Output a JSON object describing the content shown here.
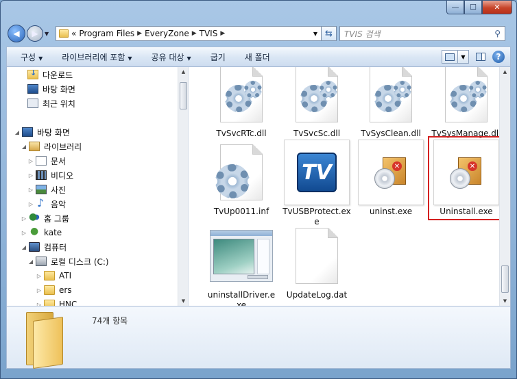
{
  "window": {
    "caption_buttons": {
      "minimize": "—",
      "maximize": "☐",
      "close": "✕"
    }
  },
  "address": {
    "prefix": "«",
    "crumbs": [
      "Program Files",
      "EveryZone",
      "TVIS"
    ],
    "search_placeholder": "TVIS 검색",
    "search_icon": "search-icon"
  },
  "toolbar": {
    "organize": "구성",
    "include_library": "라이브러리에 포함",
    "share": "공유 대상",
    "burn": "굽기",
    "new_folder": "새 폴더"
  },
  "nav": {
    "favorites": [
      {
        "label": "다운로드",
        "icon": "download-folder-icon"
      },
      {
        "label": "바탕 화면",
        "icon": "desktop-icon"
      },
      {
        "label": "최근 위치",
        "icon": "recent-places-icon"
      }
    ],
    "tree": [
      {
        "label": "바탕 화면",
        "icon": "desktop-icon",
        "expanded": true
      },
      {
        "label": "라이브러리",
        "icon": "library-icon",
        "expanded": true
      },
      {
        "label": "문서",
        "icon": "documents-icon"
      },
      {
        "label": "비디오",
        "icon": "video-icon"
      },
      {
        "label": "사진",
        "icon": "pictures-icon"
      },
      {
        "label": "음악",
        "icon": "music-icon"
      },
      {
        "label": "홈 그룹",
        "icon": "homegroup-icon"
      },
      {
        "label": "kate",
        "icon": "user-icon"
      },
      {
        "label": "컴퓨터",
        "icon": "computer-icon",
        "expanded": true
      },
      {
        "label": "로컬 디스크 (C:)",
        "icon": "drive-icon",
        "expanded": true
      },
      {
        "label": "ATI",
        "icon": "folder-icon"
      },
      {
        "label": "ers",
        "icon": "folder-icon"
      },
      {
        "label": "HNC",
        "icon": "folder-icon"
      }
    ]
  },
  "files": [
    {
      "name": "TvSvcRTc.dll",
      "kind": "dll"
    },
    {
      "name": "TvSvcSc.dll",
      "kind": "dll"
    },
    {
      "name": "TvSysClean.dll",
      "kind": "dll"
    },
    {
      "name": "TvSysManage.dll",
      "kind": "dll"
    },
    {
      "name": "TvUp0011.inf",
      "kind": "inf"
    },
    {
      "name": "TvUSBProtect.exe",
      "kind": "tv-exe",
      "logo_text": "TV"
    },
    {
      "name": "uninst.exe",
      "kind": "installer"
    },
    {
      "name": "Uninstall.exe",
      "kind": "installer",
      "highlighted": true
    },
    {
      "name": "uninstallDriver.exe",
      "kind": "screenshot-exe"
    },
    {
      "name": "UpdateLog.dat",
      "kind": "blank"
    }
  ],
  "details": {
    "item_count": "74개 항목"
  },
  "colors": {
    "highlight_border": "#d42020",
    "close_button": "#c7452a"
  }
}
